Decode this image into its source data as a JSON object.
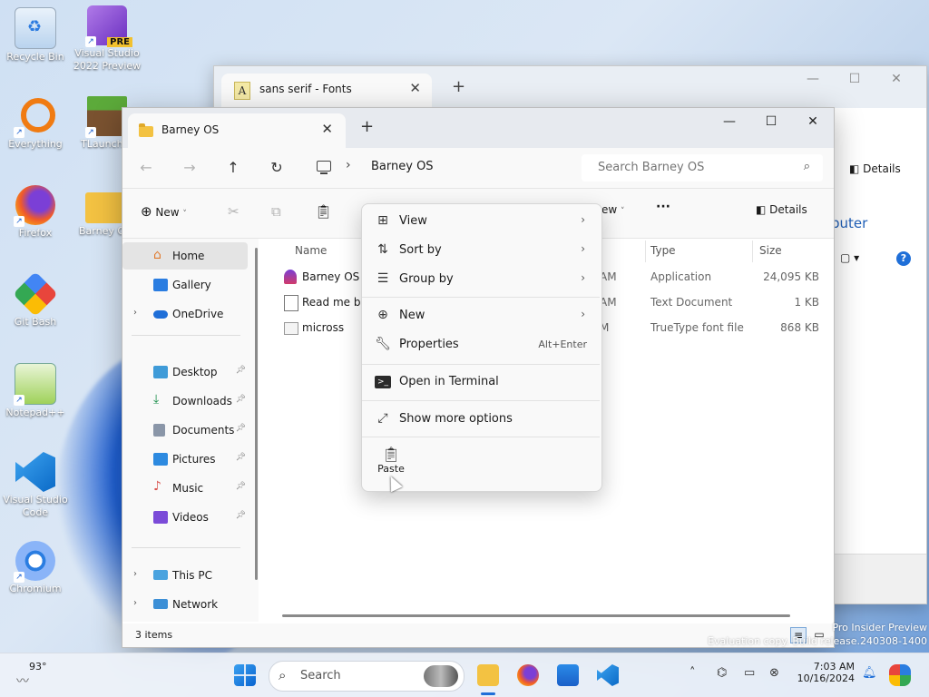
{
  "desktop": {
    "icons": [
      {
        "label": "Recycle Bin"
      },
      {
        "label": "Visual Studio 2022 Preview",
        "badge": "PRE"
      },
      {
        "label": "Everything"
      },
      {
        "label": "TLauncher"
      },
      {
        "label": "Firefox"
      },
      {
        "label": "Barney OS"
      },
      {
        "label": "Git Bash"
      },
      {
        "label": "Notepad++"
      },
      {
        "label": "Visual Studio Code"
      },
      {
        "label": "Chromium"
      }
    ],
    "watermark": "Pro Insider Preview\nEvaluation copy. Build release.240308-1400"
  },
  "back_window": {
    "tab_title": "sans serif - Fonts",
    "details_label": "Details",
    "puter_text": "puter"
  },
  "window": {
    "tab_title": "Barney OS",
    "address": {
      "crumb": "Barney OS"
    },
    "search": {
      "placeholder": "Search Barney OS"
    },
    "toolbar": {
      "new_label": "New",
      "view_label": "ew",
      "details_label": "Details"
    },
    "sidebar": {
      "items": [
        {
          "label": "Home"
        },
        {
          "label": "Gallery"
        },
        {
          "label": "OneDrive"
        },
        {
          "label": "Desktop"
        },
        {
          "label": "Downloads"
        },
        {
          "label": "Documents"
        },
        {
          "label": "Pictures"
        },
        {
          "label": "Music"
        },
        {
          "label": "Videos"
        },
        {
          "label": "This PC"
        },
        {
          "label": "Network"
        }
      ]
    },
    "columns": {
      "name": "Name",
      "type": "Type",
      "size": "Size"
    },
    "files": [
      {
        "name": "Barney OS",
        "date": "AM",
        "type": "Application",
        "size": "24,095 KB"
      },
      {
        "name": "Read me bef",
        "date": "AM",
        "type": "Text Document",
        "size": "1 KB"
      },
      {
        "name": "micross",
        "date": "M",
        "type": "TrueType font file",
        "size": "868 KB"
      }
    ],
    "status": "3 items"
  },
  "context_menu": {
    "view": "View",
    "sort_by": "Sort by",
    "group_by": "Group by",
    "new": "New",
    "properties": "Properties",
    "properties_shortcut": "Alt+Enter",
    "open_terminal": "Open in Terminal",
    "show_more": "Show more options",
    "paste": "Paste"
  },
  "taskbar": {
    "weather": "93°",
    "search_label": "Search",
    "time": "7:03 AM",
    "date": "10/16/2024"
  }
}
